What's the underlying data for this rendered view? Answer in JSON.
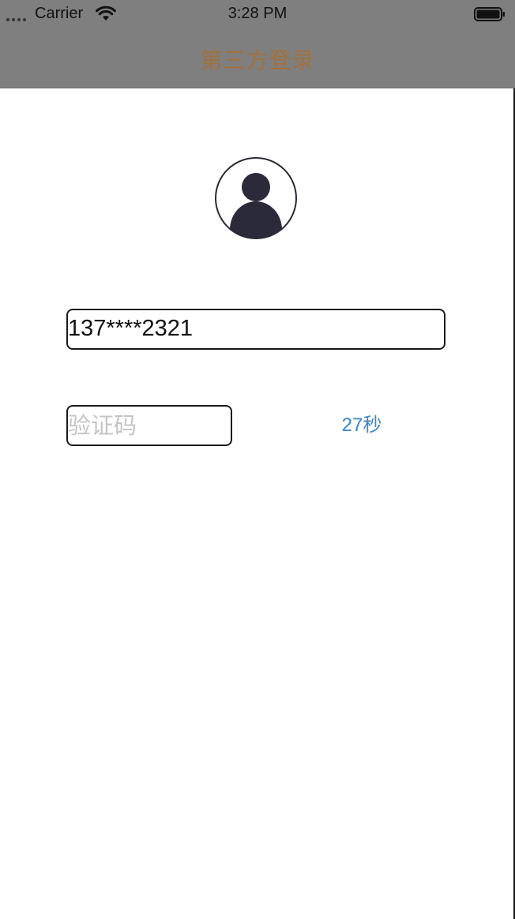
{
  "status_bar": {
    "carrier": "Carrier",
    "time": "3:28 PM",
    "signal_icon": "signal-dots-icon",
    "wifi_icon": "wifi-icon",
    "battery_icon": "battery-icon"
  },
  "nav": {
    "title": "第三方登录",
    "title_color": "#a2703c",
    "bar_color": "#7f7f7f"
  },
  "avatar": {
    "icon": "user-avatar-icon"
  },
  "form": {
    "phone_value": "137****2321",
    "code_placeholder": "验证码",
    "code_value": "",
    "countdown_label": "27秒",
    "countdown_color": "#3d86c8"
  }
}
